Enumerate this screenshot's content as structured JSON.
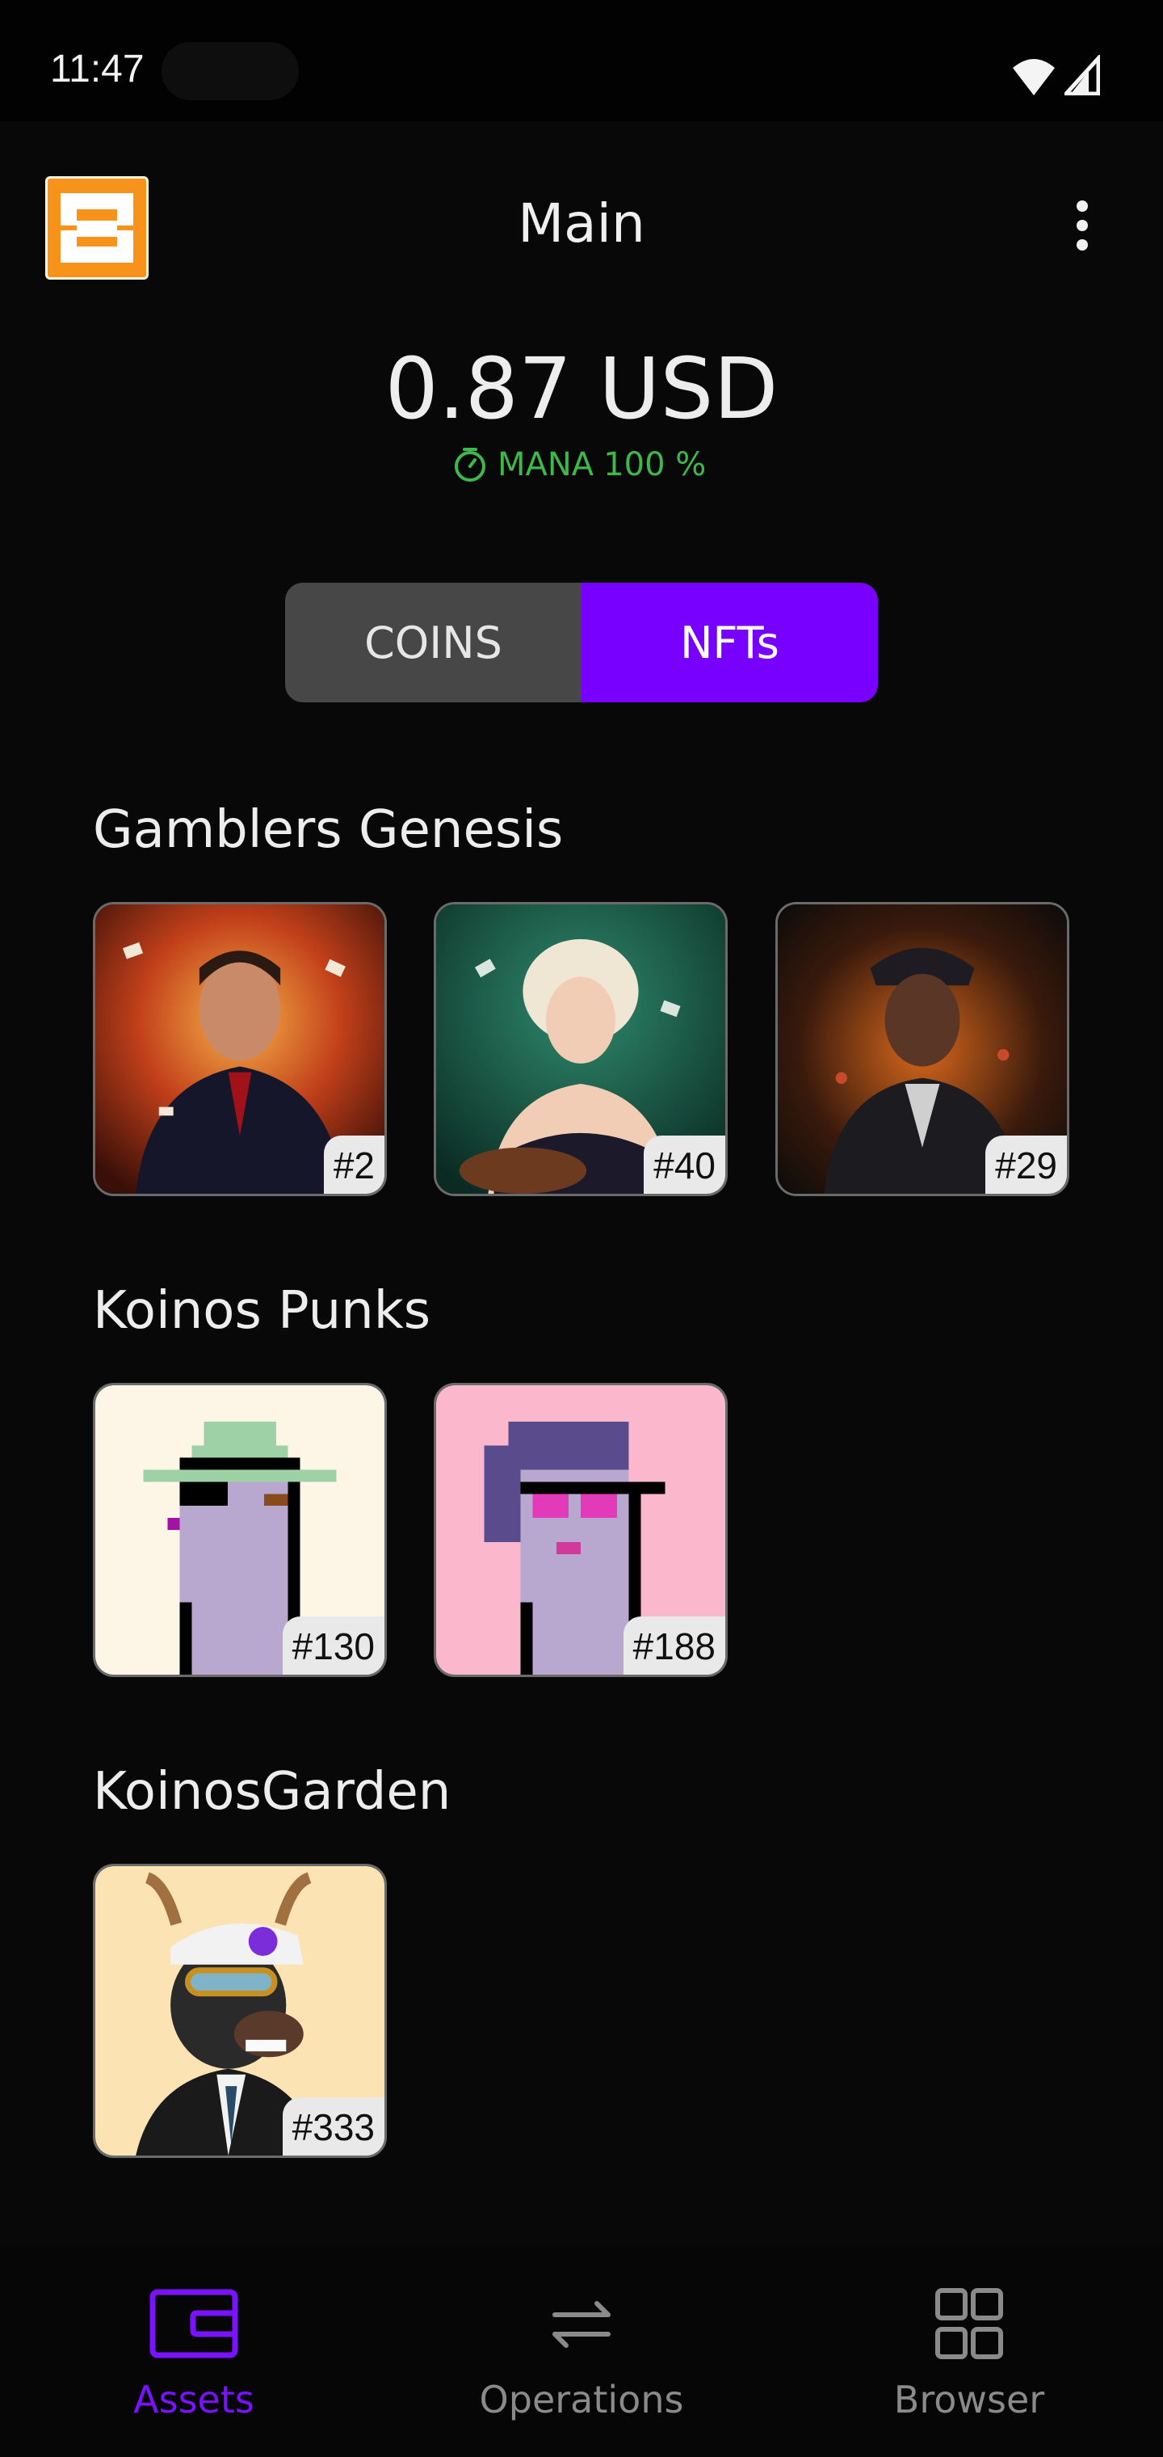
{
  "status_bar": {
    "time": "11:47"
  },
  "header": {
    "title": "Main",
    "logo_icon": "orange-wallet-logo",
    "menu_icon": "more-vert-icon"
  },
  "balance": {
    "amount": "0.87 USD",
    "mana_label": "MANA",
    "mana_percent": "100 %",
    "mana_color": "#3db84a"
  },
  "segment": {
    "coins_label": "COINS",
    "nfts_label": "NFTs",
    "selected": "NFTs",
    "accent": "#7800ff"
  },
  "collections": [
    {
      "name": "Gamblers Genesis",
      "items": [
        {
          "id": "#2"
        },
        {
          "id": "#40"
        },
        {
          "id": "#29"
        }
      ]
    },
    {
      "name": "Koinos Punks",
      "items": [
        {
          "id": "#130"
        },
        {
          "id": "#188"
        }
      ]
    },
    {
      "name": "KoinosGarden",
      "items": [
        {
          "id": "#333"
        }
      ]
    }
  ],
  "bottom_nav": [
    {
      "label": "Assets",
      "icon": "wallet-icon",
      "active": true
    },
    {
      "label": "Operations",
      "icon": "swap-arrows-icon",
      "active": false
    },
    {
      "label": "Browser",
      "icon": "grid-apps-icon",
      "active": false
    }
  ]
}
